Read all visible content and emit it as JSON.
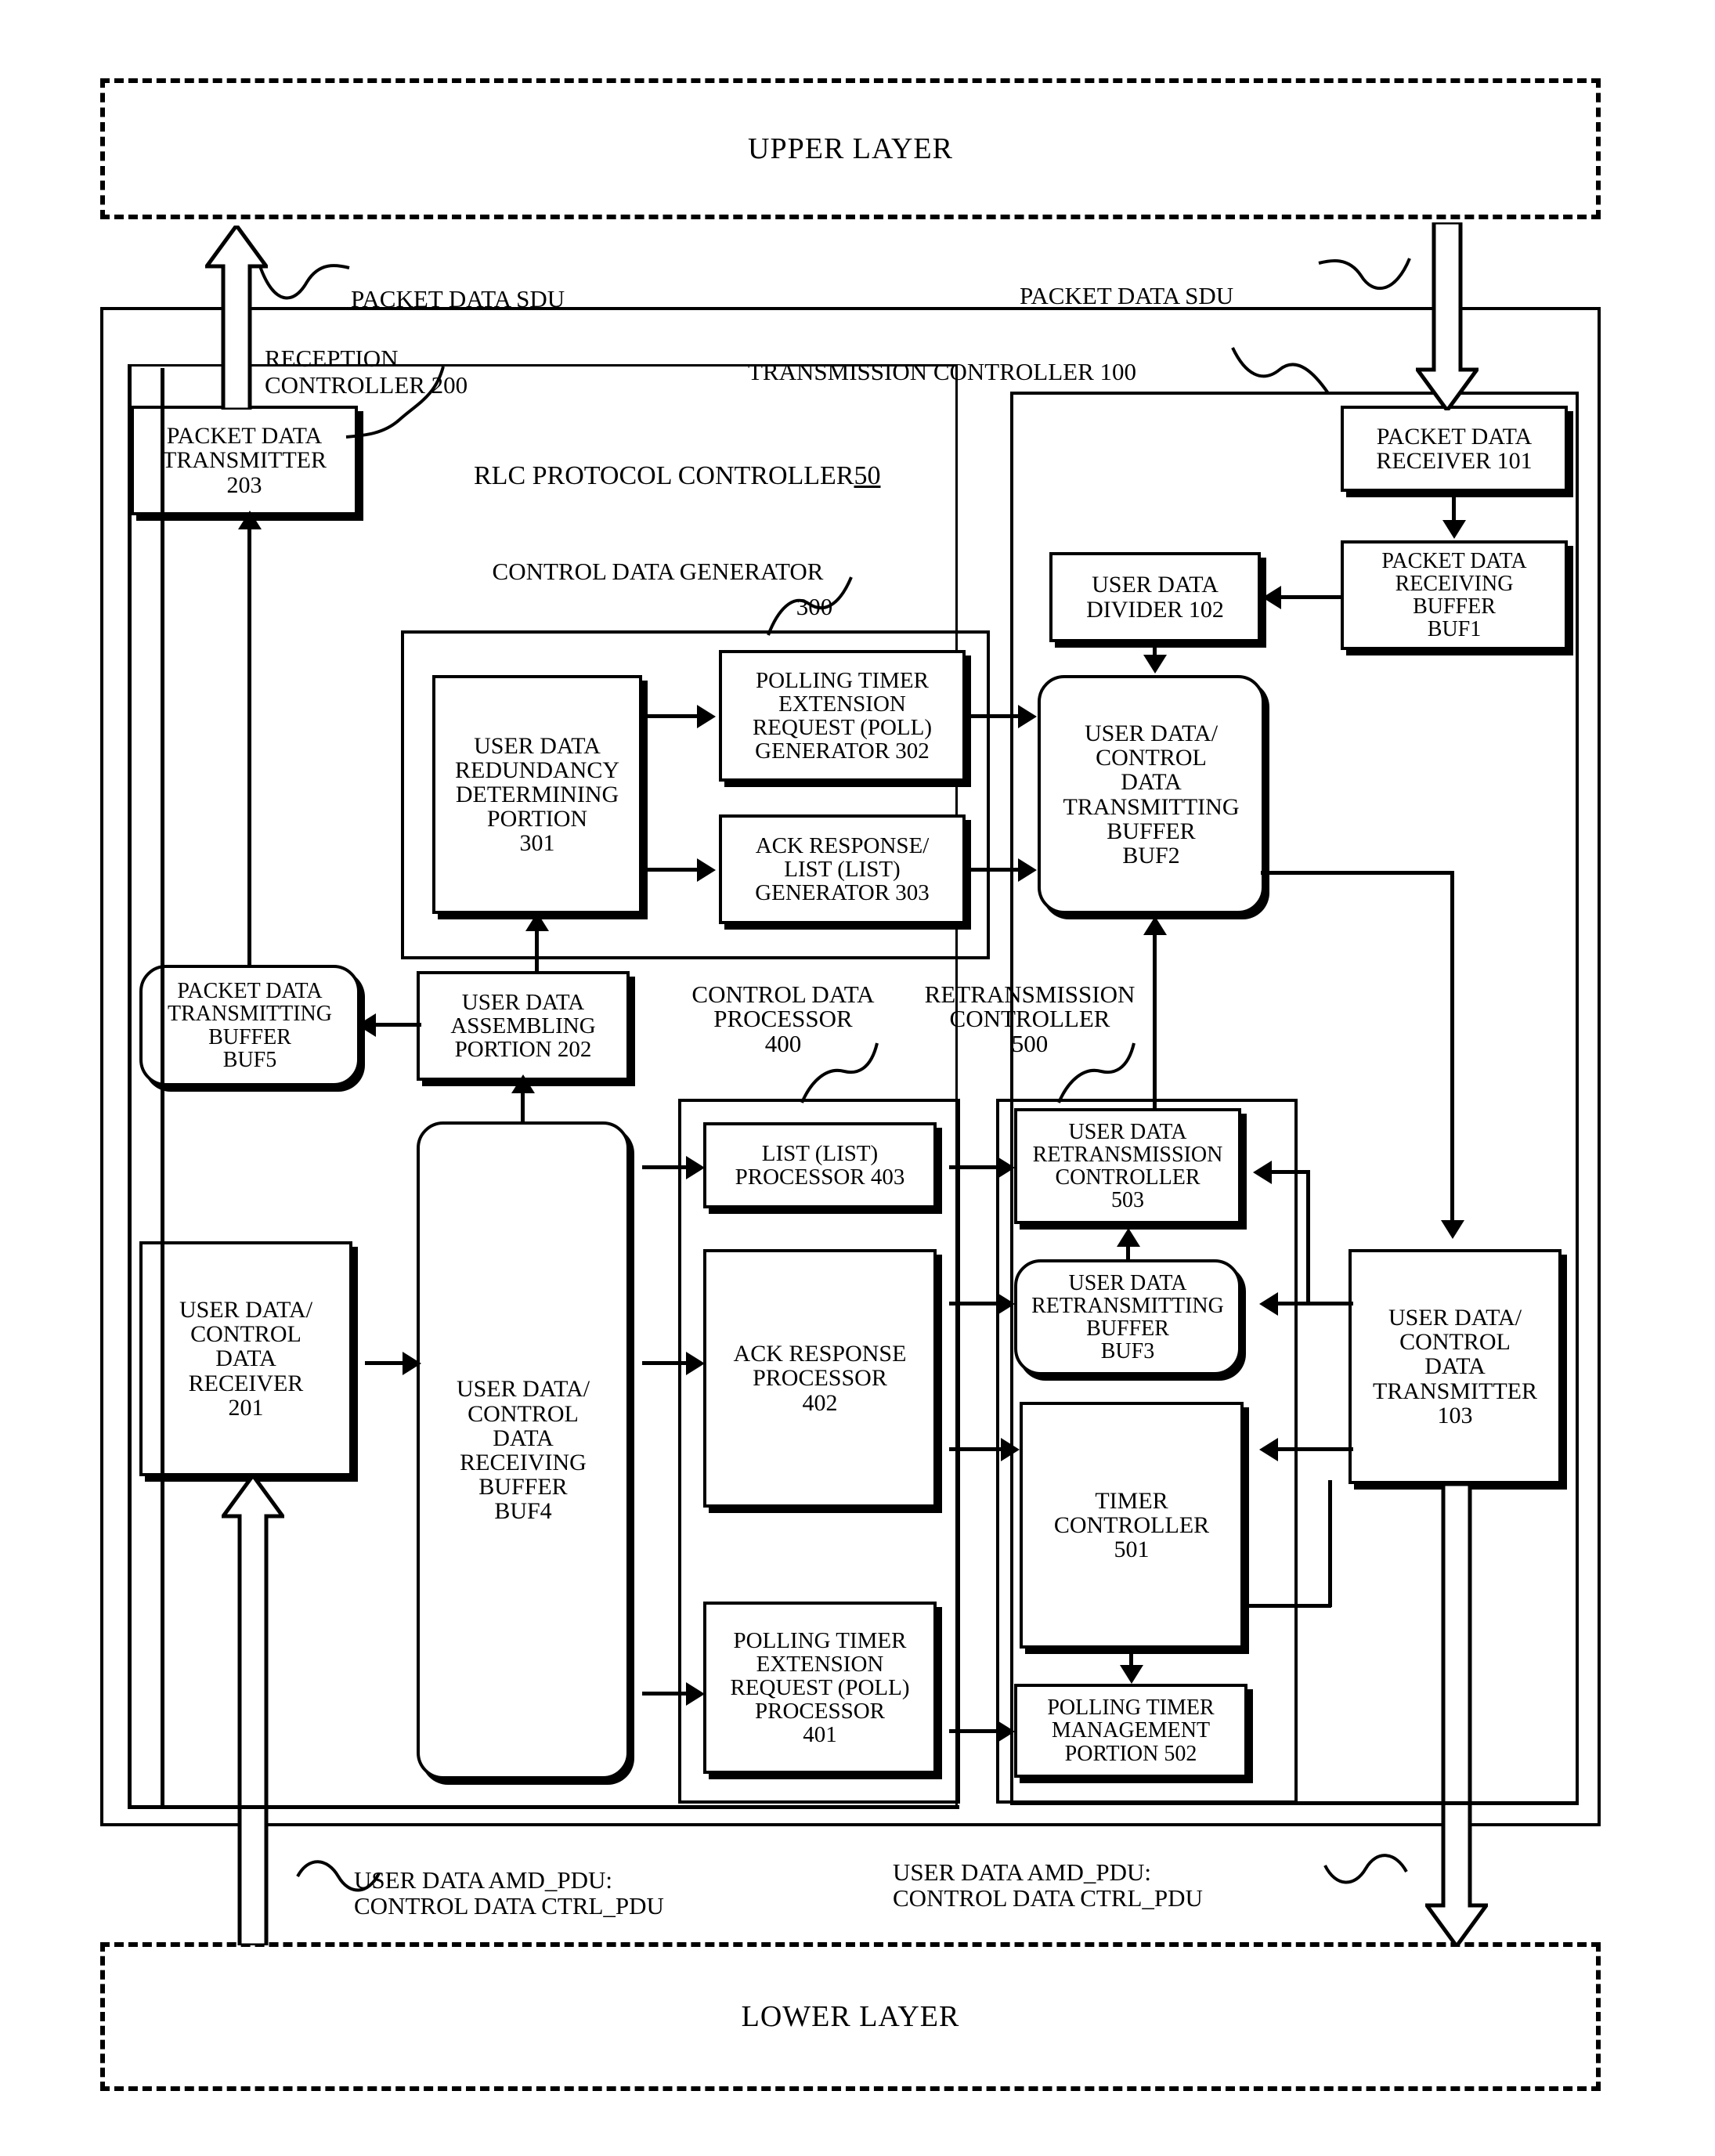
{
  "figure": {
    "upper_layer": "UPPER LAYER",
    "lower_layer": "LOWER LAYER",
    "rlc_title": "RLC PROTOCOL CONTROLLER",
    "rlc_number": "50",
    "reception_controller": "RECEPTION\nCONTROLLER 200",
    "transmission_controller": "TRANSMISSION CONTROLLER 100",
    "control_data_generator": "CONTROL DATA GENERATOR",
    "control_data_generator_num": "300",
    "control_data_processor": "CONTROL DATA\nPROCESSOR\n400",
    "retransmission_controller": "RETRANSMISSION\nCONTROLLER\n500",
    "sdu_label_left": "PACKET DATA SDU",
    "sdu_label_right": "PACKET DATA SDU",
    "pdu_label_left": "USER DATA AMD_PDU:\nCONTROL DATA CTRL_PDU",
    "pdu_label_right": "USER DATA AMD_PDU:\nCONTROL DATA CTRL_PDU"
  },
  "blocks": {
    "packet_data_transmitter_203": "PACKET DATA\nTRANSMITTER\n203",
    "packet_data_receiver_101": "PACKET DATA\nRECEIVER 101",
    "packet_data_receiving_buffer_buf1": "PACKET DATA\nRECEIVING\nBUFFER\nBUF1",
    "user_data_divider_102": "USER DATA\nDIVIDER 102",
    "user_data_redundancy_determining_portion_301": "USER DATA\nREDUNDANCY\nDETERMINING\nPORTION\n301",
    "polling_timer_extension_request_poll_generator_302": "POLLING TIMER\nEXTENSION\nREQUEST (POLL)\nGENERATOR 302",
    "ack_response_list_generator_303": "ACK RESPONSE/\nLIST (LIST)\nGENERATOR 303",
    "user_data_control_data_transmitting_buffer_buf2": "USER DATA/\nCONTROL\nDATA\nTRANSMITTING\nBUFFER\nBUF2",
    "packet_data_transmitting_buffer_buf5": "PACKET DATA\nTRANSMITTING\nBUFFER\nBUF5",
    "user_data_assembling_portion_202": "USER DATA\nASSEMBLING\nPORTION 202",
    "list_processor_403": "LIST (LIST)\nPROCESSOR 403",
    "user_data_retransmission_controller_503": "USER DATA\nRETRANSMISSION\nCONTROLLER\n503",
    "user_data_control_data_receiver_201": "USER DATA/\nCONTROL\nDATA\nRECEIVER\n201",
    "user_data_control_data_receiving_buffer_buf4": "USER DATA/\nCONTROL\nDATA\nRECEIVING\nBUFFER\nBUF4",
    "ack_response_processor_402": "ACK RESPONSE\nPROCESSOR\n402",
    "user_data_retransmitting_buffer_buf3": "USER DATA\nRETRANSMITTING\nBUFFER\nBUF3",
    "timer_controller_501": "TIMER\nCONTROLLER\n501",
    "user_data_control_data_transmitter_103": "USER DATA/\nCONTROL\nDATA\nTRANSMITTER\n103",
    "polling_timer_extension_request_poll_processor_401": "POLLING TIMER\nEXTENSION\nREQUEST (POLL)\nPROCESSOR\n401",
    "polling_timer_management_portion_502": "POLLING TIMER\nMANAGEMENT\nPORTION 502"
  }
}
